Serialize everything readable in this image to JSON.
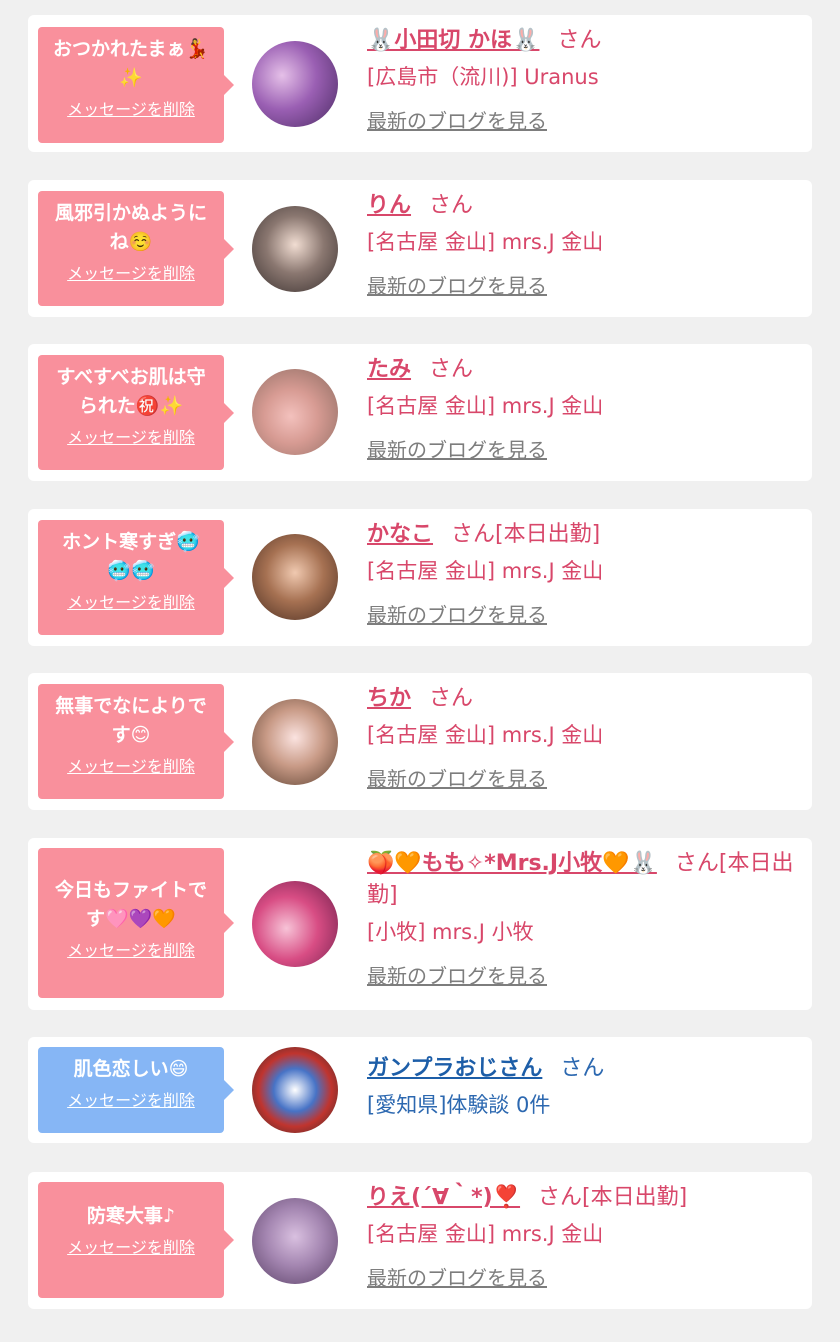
{
  "cards": [
    {
      "message": "おつかれたまぁ💃\n✨",
      "delete_label": "メッセージを削除",
      "name": "🐰小田切 かほ🐰",
      "honorific": "さん",
      "shop": "[広島市（流川)] Uranus",
      "blog_label": "最新のブログを見る",
      "theme": "pink"
    },
    {
      "message": "風邪引かぬように\nね☺️",
      "delete_label": "メッセージを削除",
      "name": "りん",
      "honorific": "さん",
      "shop": "[名古屋 金山] mrs.J 金山",
      "blog_label": "最新のブログを見る",
      "theme": "pink"
    },
    {
      "message": "すべすべお肌は守\nられた㊗️✨",
      "delete_label": "メッセージを削除",
      "name": "たみ",
      "honorific": "さん",
      "shop": "[名古屋 金山] mrs.J 金山",
      "blog_label": "最新のブログを見る",
      "theme": "pink"
    },
    {
      "message": "ホント寒すぎ🥶\n🥶🥶",
      "delete_label": "メッセージを削除",
      "name": "かなこ",
      "honorific": "さん[本日出勤]",
      "shop": "[名古屋 金山] mrs.J 金山",
      "blog_label": "最新のブログを見る",
      "theme": "pink"
    },
    {
      "message": "無事でなによりで\nす😊",
      "delete_label": "メッセージを削除",
      "name": "ちか",
      "honorific": "さん",
      "shop": "[名古屋 金山] mrs.J 金山",
      "blog_label": "最新のブログを見る",
      "theme": "pink"
    },
    {
      "message": "今日もファイトで\nす🩷💜🧡",
      "delete_label": "メッセージを削除",
      "name": "🍑🧡もも✧*Mrs.J小牧🧡🐰",
      "honorific": "さん[本日出勤]",
      "shop": "[小牧] mrs.J 小牧",
      "blog_label": "最新のブログを見る",
      "theme": "pink"
    },
    {
      "message": "肌色恋しい😄",
      "delete_label": "メッセージを削除",
      "name": "ガンプラおじさん",
      "honorific": "さん",
      "shop": "[愛知県]体験談 0件",
      "blog_label": "",
      "theme": "blue"
    },
    {
      "message": "防寒大事♪",
      "delete_label": "メッセージを削除",
      "name": "りえ(´∀｀*)❣️",
      "honorific": "さん[本日出勤]",
      "shop": "[名古屋 金山] mrs.J 金山",
      "blog_label": "最新のブログを見る",
      "theme": "pink"
    }
  ],
  "colors": {
    "page_background": "#f0f0f0",
    "card_background": "#ffffff",
    "bubble_pink": "#f9909c",
    "bubble_blue": "#86b6f5",
    "name_pink": "#d8476a",
    "name_blue": "#1d5ea8",
    "blog_link": "#7d7d7d"
  }
}
